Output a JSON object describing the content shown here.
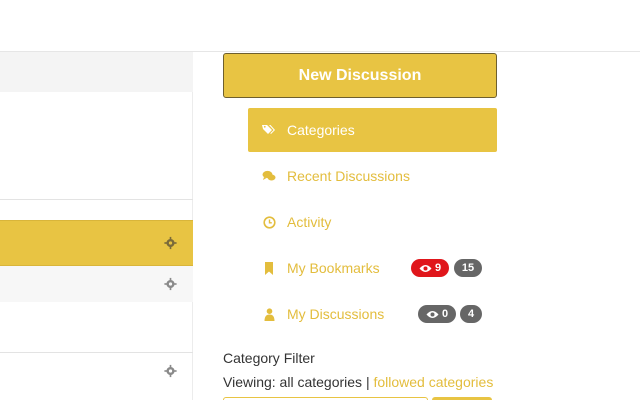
{
  "colors": {
    "accent": "#e8c443",
    "accent_text": "#e3bd3d",
    "badge_red": "#e0161b",
    "badge_grey": "#666666"
  },
  "sidebar": {
    "new_discussion_label": "New Discussion",
    "nav": [
      {
        "label": "Categories",
        "icon": "tags-icon"
      },
      {
        "label": "Recent Discussions",
        "icon": "comments-icon"
      },
      {
        "label": "Activity",
        "icon": "clock-icon"
      },
      {
        "label": "My Bookmarks",
        "icon": "bookmark-icon",
        "badges": [
          {
            "icon": "eye-icon",
            "count": "9"
          },
          {
            "count": "15"
          }
        ]
      },
      {
        "label": "My Discussions",
        "icon": "user-icon",
        "badges": [
          {
            "icon": "eye-icon",
            "count": "0"
          },
          {
            "count": "4"
          }
        ]
      }
    ]
  },
  "filter": {
    "title": "Category Filter",
    "viewing_label": "Viewing: all categories",
    "separator": "|",
    "followed_link": "followed categories"
  },
  "categories_panel": {
    "gear_icon": "gear-icon",
    "rows": 3
  }
}
